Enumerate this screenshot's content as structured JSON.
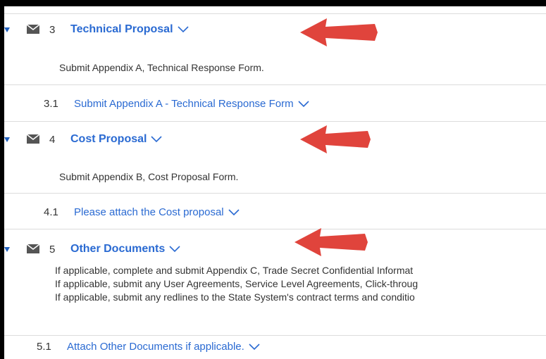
{
  "sections": [
    {
      "number": "3",
      "title": "Technical Proposal",
      "description": "Submit Appendix A, Technical Response Form.",
      "sub_number": "3.1",
      "sub_title": "Submit Appendix A - Technical Response Form"
    },
    {
      "number": "4",
      "title": "Cost Proposal",
      "description": "Submit Appendix B, Cost Proposal Form.",
      "sub_number": "4.1",
      "sub_title": "Please attach the Cost proposal"
    },
    {
      "number": "5",
      "title": "Other Documents",
      "description_lines": [
        "If applicable, complete and submit Appendix C, Trade Secret Confidential Informat",
        "If applicable, submit any User Agreements, Service Level Agreements, Click-throug",
        "If applicable, submit any redlines to the State System's contract terms and conditio"
      ],
      "sub_number": "5.1",
      "sub_title": "Attach Other Documents if applicable."
    }
  ],
  "icons": {
    "expand": "triangle-down-icon",
    "message": "envelope-icon",
    "dropdown": "chevron-down-icon",
    "annotation": "red-arrow-icon"
  },
  "colors": {
    "link": "#2a6ad2",
    "text": "#333333",
    "arrow": "#e0443c",
    "separator": "#dcdcdc"
  }
}
